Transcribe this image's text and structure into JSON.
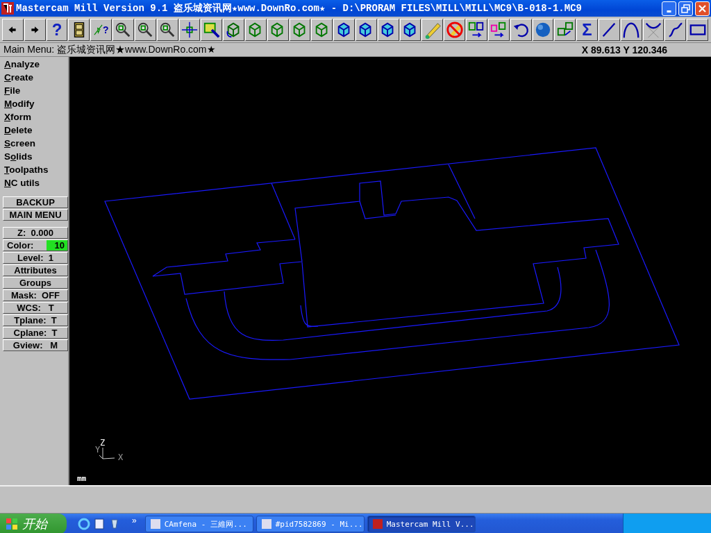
{
  "window": {
    "title": "Mastercam Mill Version 9.1 盗乐城资讯网★www.DownRo.com★ - D:\\PRORAM FILES\\MILL\\MILL\\MC9\\B-018-1.MC9"
  },
  "toolbar": [
    {
      "kind": "back"
    },
    {
      "kind": "forward"
    },
    {
      "kind": "help",
      "label": "?"
    },
    {
      "kind": "cabinet"
    },
    {
      "kind": "query",
      "label": "?"
    },
    {
      "kind": "zoom-out"
    },
    {
      "kind": "zoom"
    },
    {
      "kind": "zoom"
    },
    {
      "kind": "pan"
    },
    {
      "kind": "select"
    },
    {
      "kind": "rotate"
    },
    {
      "kind": "cube-green"
    },
    {
      "kind": "cube-green"
    },
    {
      "kind": "cube-green"
    },
    {
      "kind": "cube-green"
    },
    {
      "kind": "cube-blue"
    },
    {
      "kind": "cube-blue"
    },
    {
      "kind": "cube-blue"
    },
    {
      "kind": "cube-blue"
    },
    {
      "kind": "pencil"
    },
    {
      "kind": "no-pencil"
    },
    {
      "kind": "move"
    },
    {
      "kind": "copy"
    },
    {
      "kind": "undo"
    },
    {
      "kind": "sphere"
    },
    {
      "kind": "solid-move"
    },
    {
      "kind": "sum",
      "label": "Σ"
    },
    {
      "kind": "line"
    },
    {
      "kind": "arc"
    },
    {
      "kind": "fillet"
    },
    {
      "kind": "spline"
    },
    {
      "kind": "rectangle"
    }
  ],
  "main_menu_label": "Main Menu: 盗乐城资讯网★www.DownRo.com★",
  "coordinates": "X 89.613  Y 120.346",
  "menu": [
    {
      "hotkey": "A",
      "rest": "nalyze"
    },
    {
      "hotkey": "C",
      "rest": "reate"
    },
    {
      "hotkey": "F",
      "rest": "ile"
    },
    {
      "hotkey": "M",
      "rest": "odify"
    },
    {
      "hotkey": "X",
      "rest": "form"
    },
    {
      "hotkey": "D",
      "rest": "elete"
    },
    {
      "hotkey": "S",
      "rest": "creen"
    },
    {
      "prefix": "S",
      "hotkey": "o",
      "rest": "lids"
    },
    {
      "hotkey": "T",
      "rest": "oolpaths"
    },
    {
      "hotkey": "N",
      "rest": "C utils"
    }
  ],
  "nav_buttons": [
    "BACKUP",
    "MAIN MENU"
  ],
  "status_buttons": [
    {
      "kind": "plain",
      "label": "Z:  0.000"
    },
    {
      "kind": "color",
      "label": "Color:",
      "value": "10",
      "color": "#22e022"
    },
    {
      "kind": "plain",
      "label": "Level:  1"
    },
    {
      "kind": "plain",
      "label": "Attributes"
    },
    {
      "kind": "plain",
      "label": "Groups"
    },
    {
      "kind": "plain",
      "label": "Mask:  OFF"
    },
    {
      "kind": "plain",
      "label": "WCS:   T"
    },
    {
      "kind": "plain",
      "label": "Tplane:  T"
    },
    {
      "kind": "plain",
      "label": "Cplane:  T"
    },
    {
      "kind": "plain",
      "label": "Gview:   M"
    }
  ],
  "axes": {
    "z": "Z",
    "y": "Y",
    "x": "X"
  },
  "units": "mm",
  "taskbar": {
    "start": "开始",
    "more": "»",
    "tasks": [
      {
        "label": "CAmfena - 三維网...",
        "selected": false
      },
      {
        "label": "#pid7582869 - Mi...",
        "selected": false
      },
      {
        "label": "Mastercam Mill V...",
        "selected": true
      }
    ]
  }
}
